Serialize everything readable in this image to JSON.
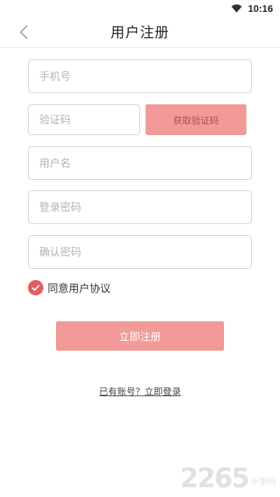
{
  "status_bar": {
    "time": "10:16",
    "icons": [
      "wifi-icon"
    ]
  },
  "header": {
    "title": "用户注册",
    "back_icon": "chevron-left-icon"
  },
  "form": {
    "phone_placeholder": "手机号",
    "code_placeholder": "验证码",
    "get_code_label": "获取验证码",
    "username_placeholder": "用户名",
    "password_placeholder": "登录密码",
    "confirm_password_placeholder": "确认密码",
    "agree_label": "同意用户协议",
    "agree_checked": true,
    "register_label": "立即注册",
    "login_link": "已有账号？立即登录"
  },
  "watermark": {
    "number": "2265",
    "text": "手游网"
  },
  "colors": {
    "accent": "#f29a97",
    "check": "#e0605f",
    "button_text_dark": "#b24b47"
  }
}
